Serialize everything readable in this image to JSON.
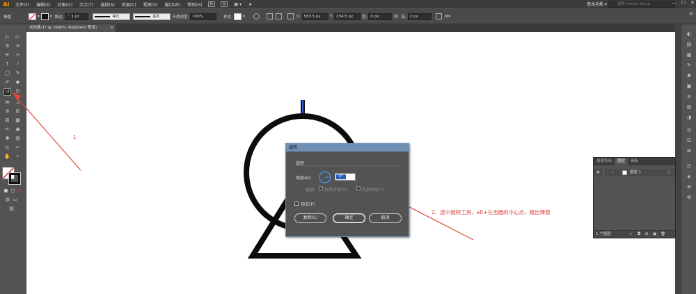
{
  "app": {
    "logo": "Ai"
  },
  "menu": [
    "文件(F)",
    "编辑(E)",
    "对象(O)",
    "文字(T)",
    "选择(S)",
    "效果(C)",
    "视图(V)",
    "窗口(W)",
    "帮助(H)"
  ],
  "menu_icons": [
    "Br",
    "St"
  ],
  "workspace": "基本功能",
  "search_placeholder": "搜索 Adobe Stock",
  "control": {
    "selection": "椭圆",
    "stroke_label": "描边:",
    "stroke_weight": "1 pt",
    "profile": "等比",
    "brush": "基本",
    "opacity_label": "不透明度:",
    "opacity": "100%",
    "style_label": "样式:",
    "x_label": "X:",
    "x": "583.5 px",
    "y_label": "Y:",
    "y": "254.5 px",
    "w_label": "宽:",
    "w": "0 px",
    "h_label": "高:",
    "h": "2 px"
  },
  "doc_tab": {
    "title": "未标题-1* @ 1600% (RGB/GPU 预览)",
    "close": "×"
  },
  "layers_panel": {
    "tabs": [
      "资源导出",
      "图层",
      "画板"
    ],
    "active_tab": "图层",
    "layer_name": "图层 1",
    "footer": "1 个图层"
  },
  "dialog": {
    "title": "旋转",
    "section": "旋转",
    "angle_label": "角度(A):",
    "angle_value": "0°",
    "options_label": "选项:",
    "transform_objects": "变换对象(O)",
    "transform_patterns": "变换图案(T)",
    "preview": "预览(P)",
    "copy_button": "复制(C)",
    "ok_button": "确定",
    "cancel_button": "取消"
  },
  "annotations": {
    "note1": "1",
    "note2": "2、选中旋转工具，alt+左击圆的中心点，跳出弹窗"
  },
  "colors": {
    "annotation": "#e03c31",
    "dialog_title": "#6f8fb5",
    "selection": "#2c5fbd"
  }
}
